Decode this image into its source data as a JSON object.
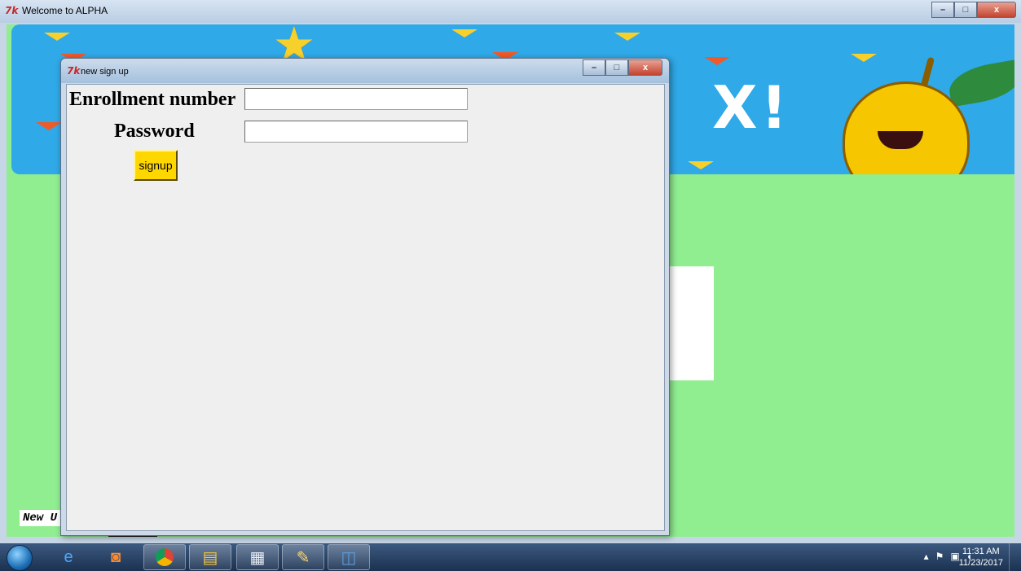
{
  "main_window": {
    "icon": "7k",
    "title": "Welcome to ALPHA",
    "new_label": "New U"
  },
  "dialog": {
    "icon": "7k",
    "title": "new sign up",
    "enroll_label": "Enrollment number",
    "password_label": "Password",
    "enroll_value": "",
    "password_value": "",
    "signup_button": "signup"
  },
  "window_controls": {
    "minimize": "–",
    "maximize": "□",
    "close": "x"
  },
  "taskbar": {
    "items": [
      "windows-start",
      "internet-explorer",
      "media-player",
      "chrome",
      "file-explorer",
      "notepad-files",
      "paint",
      "python-idle"
    ],
    "tray_icons": [
      "show-hidden",
      "flag",
      "network",
      "volume"
    ],
    "clock_time": "11:31 AM",
    "clock_date": "11/23/2017"
  },
  "colors": {
    "client_background": "#90ee90",
    "dialog_background": "#efefef",
    "signup_button": "#ffd700",
    "banner": "#2fa9e8"
  }
}
